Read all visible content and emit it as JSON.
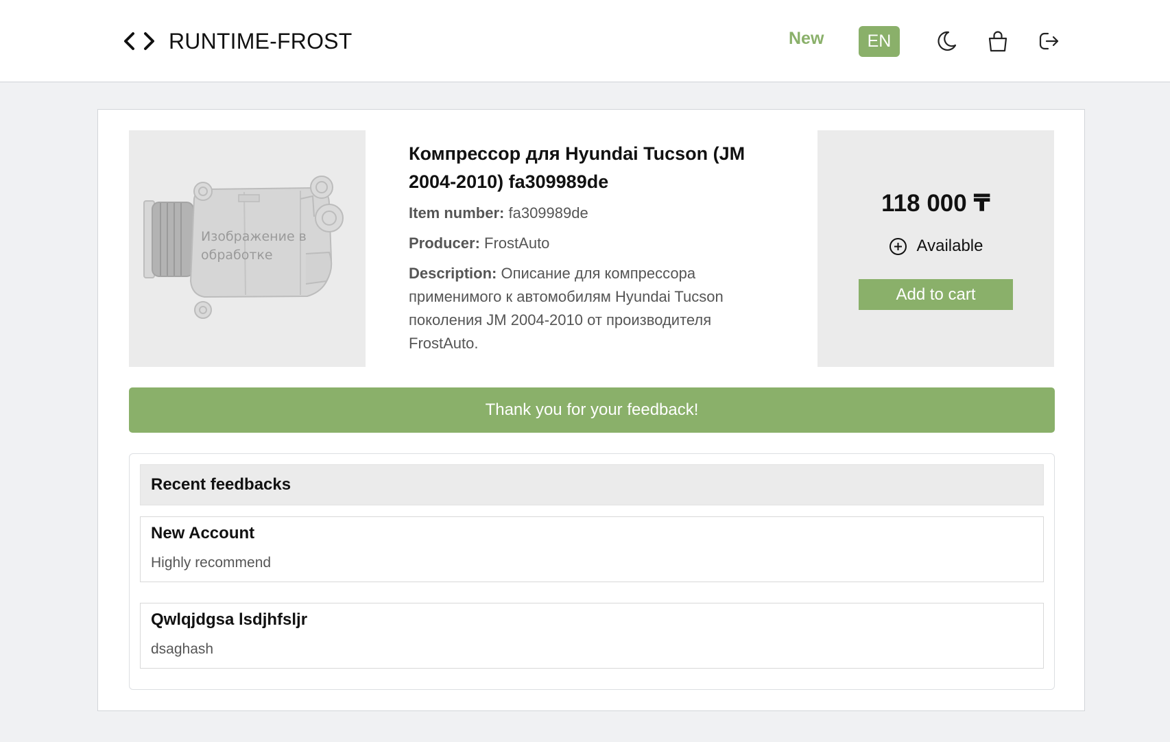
{
  "header": {
    "brand_name": "RUNTIME-FROST",
    "brand_icon": "code-brackets-icon",
    "nav_new": "New",
    "lang": "EN",
    "icons": [
      "moon-icon",
      "shopping-bag-icon",
      "logout-icon"
    ]
  },
  "product": {
    "image_caption": "Изображение в обработке",
    "title": "Компрессор для Hyundai Tucson (JM 2004-2010) fa309989de",
    "item_number_label": "Item number:",
    "item_number": "fa309989de",
    "producer_label": "Producer:",
    "producer": "FrostAuto",
    "description_label": "Description:",
    "description": "Описание для компрессора применимого к автомобилям Hyundai Tucson поколения JM 2004-2010 от производителя FrostAuto."
  },
  "purchase": {
    "price": "118 000 ₸",
    "availability": "Available",
    "add_to_cart": "Add to cart"
  },
  "notice": "Thank you for your feedback!",
  "feedbacks": {
    "heading": "Recent feedbacks",
    "items": [
      {
        "author": "New Account",
        "text": "Highly recommend"
      },
      {
        "author": "Qwlqjdgsa lsdjhfsljr",
        "text": "dsaghash"
      }
    ]
  },
  "colors": {
    "accent": "#8ab06a",
    "page_bg": "#f0f1f3",
    "panel_bg": "#ebebeb"
  }
}
